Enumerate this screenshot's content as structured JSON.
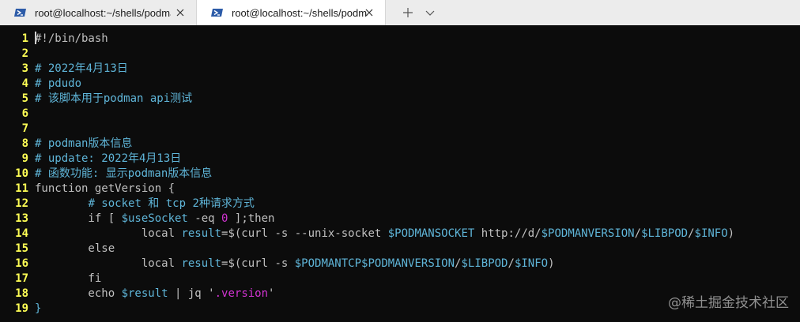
{
  "tabs": [
    {
      "title": "root@localhost:~/shells/podma",
      "active": false
    },
    {
      "title": "root@localhost:~/shells/podma",
      "active": true
    }
  ],
  "icons": {
    "tab_icon": "powershell-icon",
    "close": "close-icon",
    "new_tab": "plus-icon",
    "dropdown": "chevron-down-icon"
  },
  "colors": {
    "line_number": "#ffff55",
    "comment": "#5fb5d8",
    "variable": "#5fb5d8",
    "string_number": "#d233d2",
    "text": "#c0c0c0",
    "background": "#0c0c0c"
  },
  "editor": {
    "lines": [
      {
        "num": "1",
        "segs": [
          {
            "t": "#!/bin/bash",
            "c": "plain"
          }
        ]
      },
      {
        "num": "2",
        "segs": []
      },
      {
        "num": "3",
        "segs": [
          {
            "t": "# 2022年4月13日",
            "c": "comment"
          }
        ]
      },
      {
        "num": "4",
        "segs": [
          {
            "t": "# pdudo",
            "c": "comment"
          }
        ]
      },
      {
        "num": "5",
        "segs": [
          {
            "t": "# 该脚本用于podman api测试",
            "c": "comment"
          }
        ]
      },
      {
        "num": "6",
        "segs": []
      },
      {
        "num": "7",
        "segs": []
      },
      {
        "num": "8",
        "segs": [
          {
            "t": "# podman版本信息",
            "c": "comment"
          }
        ]
      },
      {
        "num": "9",
        "segs": [
          {
            "t": "# update: 2022年4月13日",
            "c": "comment"
          }
        ]
      },
      {
        "num": "10",
        "segs": [
          {
            "t": "# 函数功能: 显示podman版本信息",
            "c": "comment"
          }
        ]
      },
      {
        "num": "11",
        "segs": [
          {
            "t": "function getVersion {",
            "c": "plain"
          }
        ]
      },
      {
        "num": "12",
        "segs": [
          {
            "t": "        ",
            "c": "plain"
          },
          {
            "t": "# socket 和 tcp 2种请求方式",
            "c": "comment"
          }
        ]
      },
      {
        "num": "13",
        "segs": [
          {
            "t": "        if [ ",
            "c": "plain"
          },
          {
            "t": "$useSocket",
            "c": "var"
          },
          {
            "t": " -eq ",
            "c": "plain"
          },
          {
            "t": "0",
            "c": "num"
          },
          {
            "t": " ];then",
            "c": "plain"
          }
        ]
      },
      {
        "num": "14",
        "segs": [
          {
            "t": "                local ",
            "c": "plain"
          },
          {
            "t": "result",
            "c": "var"
          },
          {
            "t": "=$(curl -s --unix-socket ",
            "c": "plain"
          },
          {
            "t": "$PODMANSOCKET",
            "c": "var"
          },
          {
            "t": " http://d/",
            "c": "plain"
          },
          {
            "t": "$PODMANVERSION",
            "c": "var"
          },
          {
            "t": "/",
            "c": "plain"
          },
          {
            "t": "$LIBPOD",
            "c": "var"
          },
          {
            "t": "/",
            "c": "plain"
          },
          {
            "t": "$INFO",
            "c": "var"
          },
          {
            "t": ")",
            "c": "plain"
          }
        ]
      },
      {
        "num": "15",
        "segs": [
          {
            "t": "        else",
            "c": "plain"
          }
        ]
      },
      {
        "num": "16",
        "segs": [
          {
            "t": "                local ",
            "c": "plain"
          },
          {
            "t": "result",
            "c": "var"
          },
          {
            "t": "=$(curl -s ",
            "c": "plain"
          },
          {
            "t": "$PODMANTCP",
            "c": "var"
          },
          {
            "t": "$PODMANVERSION",
            "c": "var"
          },
          {
            "t": "/",
            "c": "plain"
          },
          {
            "t": "$LIBPOD",
            "c": "var"
          },
          {
            "t": "/",
            "c": "plain"
          },
          {
            "t": "$INFO",
            "c": "var"
          },
          {
            "t": ")",
            "c": "plain"
          }
        ]
      },
      {
        "num": "17",
        "segs": [
          {
            "t": "        fi",
            "c": "plain"
          }
        ]
      },
      {
        "num": "18",
        "segs": [
          {
            "t": "        echo ",
            "c": "plain"
          },
          {
            "t": "$result",
            "c": "var"
          },
          {
            "t": " | jq '",
            "c": "plain"
          },
          {
            "t": ".version",
            "c": "str"
          },
          {
            "t": "'",
            "c": "plain"
          }
        ]
      },
      {
        "num": "19",
        "segs": [
          {
            "t": "}",
            "c": "var"
          }
        ]
      }
    ]
  },
  "watermark": "@稀土掘金技术社区"
}
